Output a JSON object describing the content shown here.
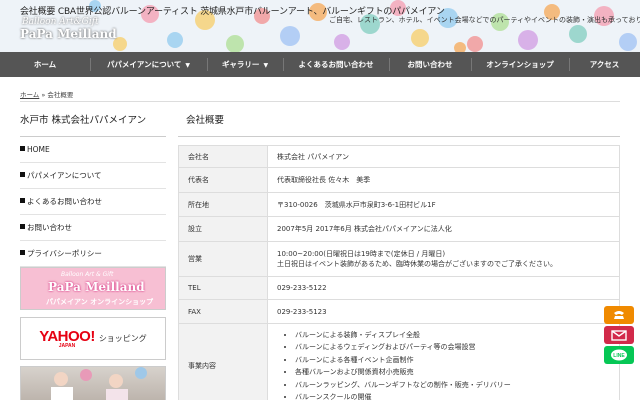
{
  "header": {
    "tagline": "会社概要 CBA世界公認バルーンアーティスト 茨城県水戸市バルーンアート、バルーンギフトのパパメイアン",
    "logo_small": "Balloon Art&Gift",
    "logo_big": "PaPa Meilland",
    "sub_text": "ご自宅、レストラン、ホテル、イベント会場などでのパーティやイベントの装飾・演出も承っております。"
  },
  "nav": [
    {
      "label": "ホーム",
      "caret": false
    },
    {
      "label": "パパメイアンについて",
      "caret": true
    },
    {
      "label": "ギャラリー",
      "caret": true
    },
    {
      "label": "よくあるお問い合わせ",
      "caret": false
    },
    {
      "label": "お問い合わせ",
      "caret": false
    },
    {
      "label": "オンラインショップ",
      "caret": false
    },
    {
      "label": "アクセス",
      "caret": false
    }
  ],
  "breadcrumb": {
    "home": "ホーム",
    "sep": " » ",
    "current": "会社概要"
  },
  "sidebar": {
    "title": "水戸市 株式会社パパメイアン",
    "links": [
      "HOME",
      "パパメイアンについて",
      "よくあるお問い合わせ",
      "お問い合わせ",
      "プライバシーポリシー"
    ],
    "banner_shop": {
      "line1": "Balloon Art & Gift",
      "line2": "PaPa Meilland",
      "line3": "パパメイアン オンラインショップ"
    },
    "banner_yahoo": {
      "logo": "YAHOO!",
      "logo_sub": "JAPAN",
      "text": "ショッピング"
    }
  },
  "main": {
    "title": "会社概要",
    "rows": [
      {
        "label": "会社名",
        "value": "株式会社 パパメイアン"
      },
      {
        "label": "代表名",
        "value": "代表取締役社長 佐々木　美季"
      },
      {
        "label": "所在地",
        "value": "〒310-0026　茨城県水戸市泉町3-6-1田村ビル1F"
      },
      {
        "label": "設立",
        "value": "2007年5月 2017年6月 株式会社パパメイアンに法人化"
      },
      {
        "label": "営業",
        "value": "10:00~20:00(日曜祝日は19時まで(定休日 / 月曜日)",
        "value2": "土日祝日はイベント装飾があるため、臨時休業の場合がございますのでご了承ください。"
      },
      {
        "label": "TEL",
        "value": "029-233-5122"
      },
      {
        "label": "FAX",
        "value": "029-233-5123"
      }
    ],
    "business": {
      "label": "事業内容",
      "items": [
        "バルーンによる装飾・ディスプレイ全般",
        "バルーンによるウェディングおよびパーティ等の会場設営",
        "バルーンによる各種イベント企画制作",
        "各種バルーンおよび関係資材小売販売",
        "バルーンラッピング、バルーンギフトなどの制作・販売・デリバリー",
        "バルーンスクールの開催"
      ]
    }
  },
  "floating": {
    "line_label": "LINE"
  },
  "colors": {
    "nav_bg": "#555555",
    "phone": "#f08a00",
    "mail": "#d22a4a",
    "line": "#06c755",
    "shop_banner": "#f7bfd3"
  }
}
